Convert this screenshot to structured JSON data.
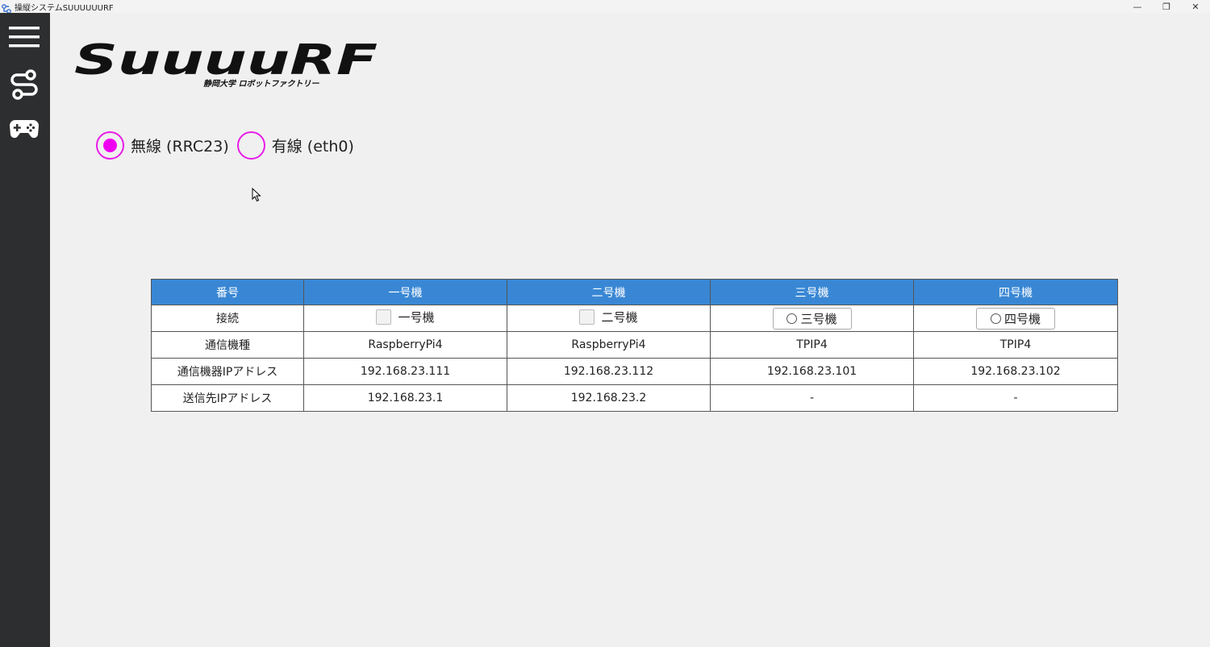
{
  "window": {
    "title": "操縦システムSUUUUUURF",
    "controls": [
      "—",
      "❐",
      "✕"
    ]
  },
  "sidebar": {
    "items": [
      {
        "name": "menu",
        "icon": "hamburger-menu-icon"
      },
      {
        "name": "connection",
        "icon": "route-icon"
      },
      {
        "name": "controller",
        "icon": "gamepad-icon"
      }
    ]
  },
  "logo": {
    "text": "SuuuuRF",
    "subtitle": "静岡大学 ロボットファクトリー"
  },
  "network": {
    "options": [
      {
        "label": "無線 (RRC23)",
        "selected": true
      },
      {
        "label": "有線 (eth0)",
        "selected": false
      }
    ],
    "accent": "#f000f0"
  },
  "table": {
    "headers": [
      "番号",
      "一号機",
      "二号機",
      "三号機",
      "四号機"
    ],
    "header_color": "#3987d4",
    "rows": [
      {
        "label": "接続",
        "cells": [
          "一号機",
          "二号機",
          "三号機",
          "四号機"
        ]
      },
      {
        "label": "通信機種",
        "cells": [
          "RaspberryPi4",
          "RaspberryPi4",
          "TPIP4",
          "TPIP4"
        ]
      },
      {
        "label": "通信機器IPアドレス",
        "cells": [
          "192.168.23.111",
          "192.168.23.112",
          "192.168.23.101",
          "192.168.23.102"
        ]
      },
      {
        "label": "送信先IPアドレス",
        "cells": [
          "192.168.23.1",
          "192.168.23.2",
          "-",
          "-"
        ]
      }
    ]
  }
}
